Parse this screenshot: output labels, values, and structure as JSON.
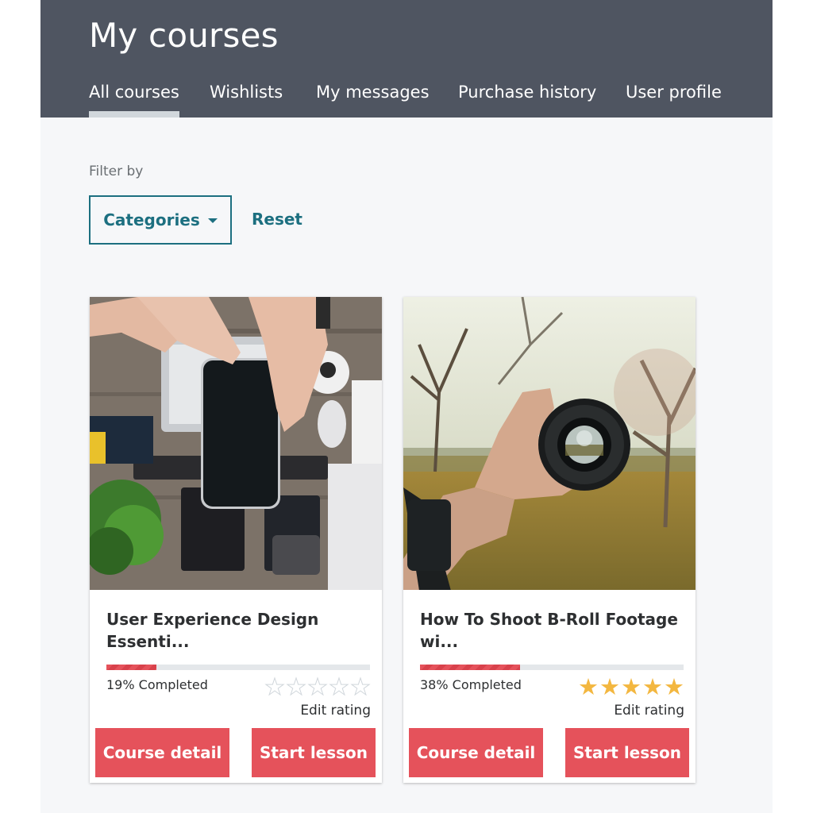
{
  "header": {
    "title": "My courses",
    "tabs": [
      {
        "label": "All courses",
        "active": true
      },
      {
        "label": "Wishlists",
        "active": false
      },
      {
        "label": "My messages",
        "active": false
      },
      {
        "label": "Purchase history",
        "active": false
      },
      {
        "label": "User profile",
        "active": false
      }
    ]
  },
  "filter": {
    "label": "Filter by",
    "categories_label": "Categories",
    "reset_label": "Reset"
  },
  "courses": [
    {
      "title": "User Experience Design Essenti...",
      "progress_percent": 19,
      "progress_text": "19% Completed",
      "rating_filled": 0,
      "rating_max": 5,
      "edit_rating_label": "Edit rating",
      "detail_label": "Course detail",
      "start_label": "Start lesson",
      "thumbnail": "phone-on-desk-image"
    },
    {
      "title": "How To Shoot B-Roll Footage wi...",
      "progress_percent": 38,
      "progress_text": "38% Completed",
      "rating_filled": 5,
      "rating_max": 5,
      "edit_rating_label": "Edit rating",
      "detail_label": "Course detail",
      "start_label": "Start lesson",
      "thumbnail": "camera-lens-in-hand-image"
    }
  ],
  "colors": {
    "header_bg": "#4f5561",
    "accent_teal": "#1c6f80",
    "button_red": "#e5525b",
    "star_gold": "#f3b740"
  }
}
